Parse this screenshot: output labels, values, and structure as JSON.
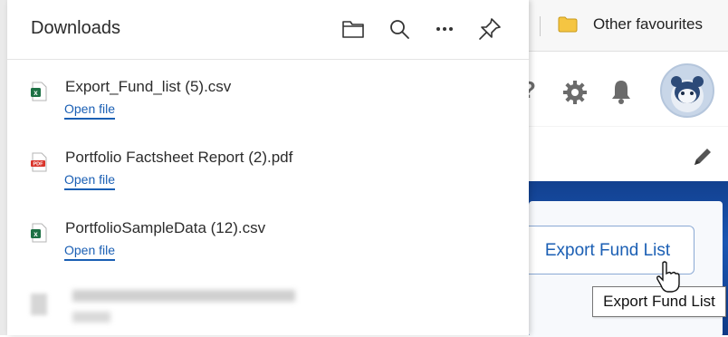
{
  "browser": {
    "bookmark_folder_label": "Other favourites"
  },
  "downloads_panel": {
    "title": "Downloads",
    "toolbar_icons": [
      "folder-icon",
      "search-icon",
      "more-icon",
      "pin-icon"
    ],
    "items": [
      {
        "file_name": "Export_Fund_list (5).csv",
        "action": "Open file",
        "file_type": "csv",
        "icon": "excel-file-icon"
      },
      {
        "file_name": "Portfolio Factsheet Report (2).pdf",
        "action": "Open file",
        "file_type": "pdf",
        "icon": "pdf-file-icon"
      },
      {
        "file_name": "PortfolioSampleData (12).csv",
        "action": "Open file",
        "file_type": "csv",
        "icon": "excel-file-icon"
      }
    ]
  },
  "page": {
    "header_icons": [
      "help-icon",
      "gear-icon",
      "bell-icon",
      "avatar"
    ],
    "export_button_label": "Export Fund List",
    "tooltip_text": "Export Fund List"
  },
  "colors": {
    "link_blue": "#1a5fb4",
    "brand_blue": "#1a56b3",
    "excel_green": "#1e7145",
    "pdf_red": "#d9342b"
  }
}
